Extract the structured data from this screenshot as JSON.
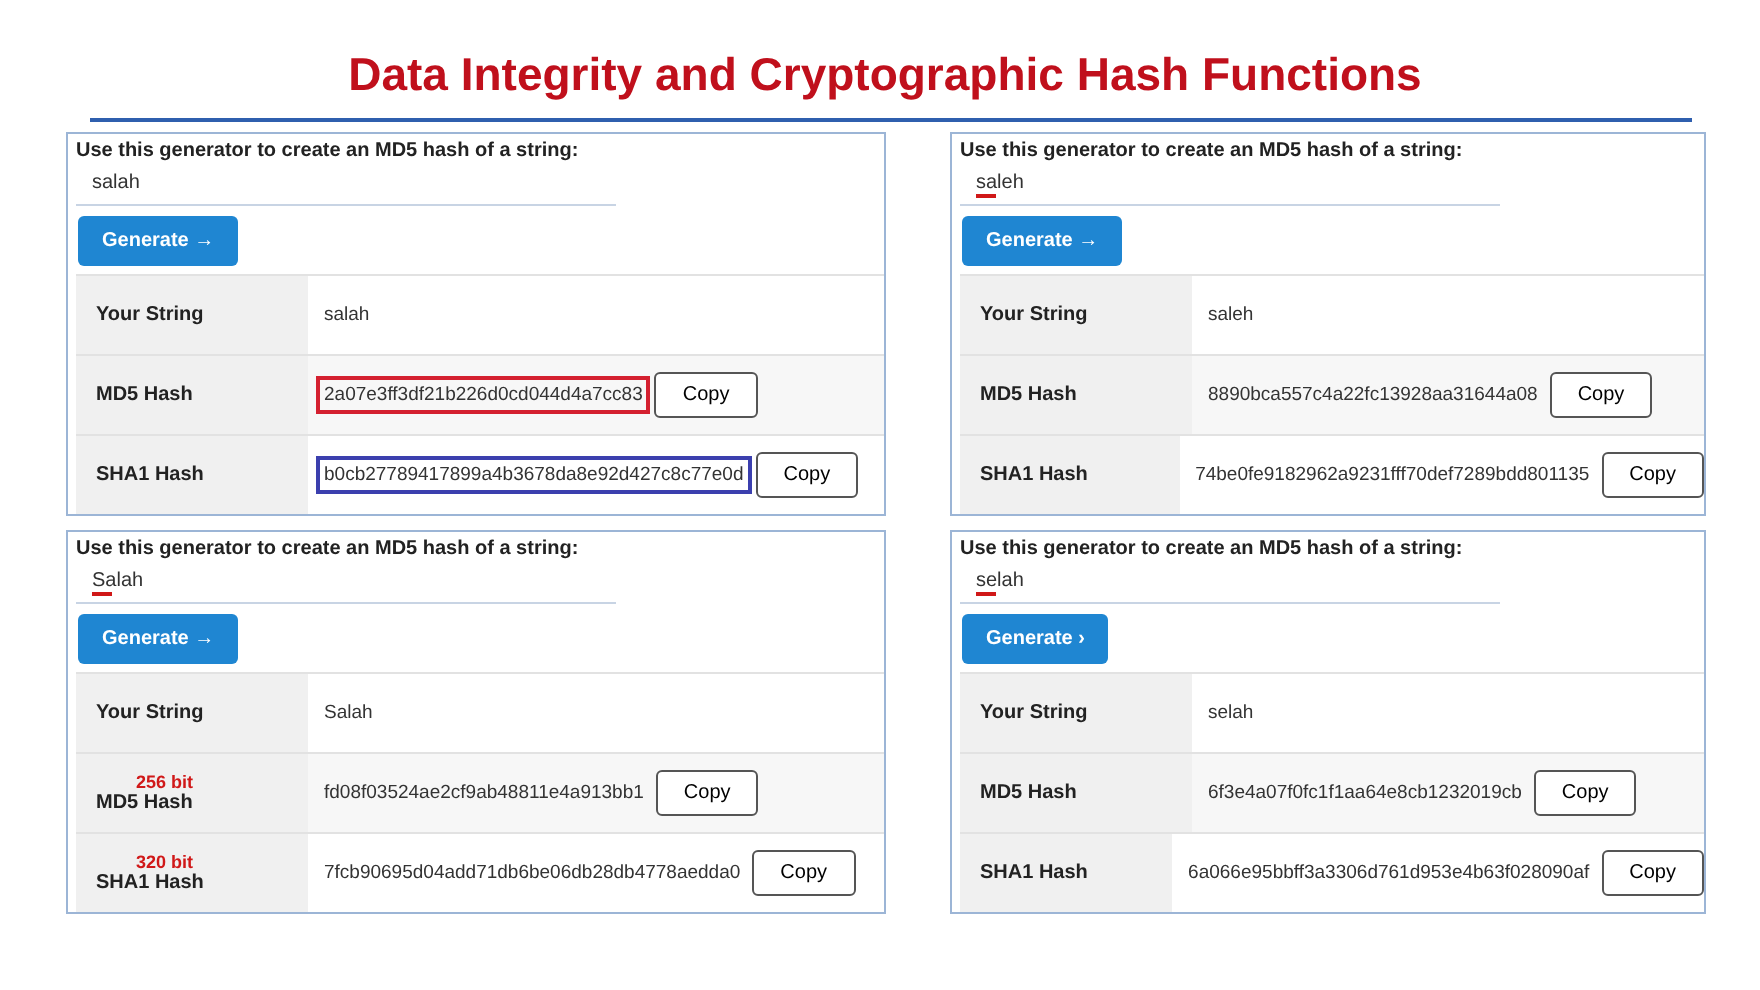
{
  "title": "Data Integrity and Cryptographic Hash Functions",
  "panels": [
    {
      "prompt": "Use this generator to create an MD5 hash of a string:",
      "input": {
        "value": "salah",
        "marked": false
      },
      "button": "Generate →",
      "rows": [
        {
          "label": "Your String",
          "value": "salah"
        },
        {
          "label": "MD5 Hash",
          "value": "2a07e3ff3df21b226d0cd044d4a7cc83",
          "copy": "Copy",
          "color": "#d42030"
        },
        {
          "label": "SHA1 Hash",
          "value": "b0cb27789417899a4b3678da8e92d427c8c77e0d",
          "copy": "Copy",
          "color": "#3b3fae"
        }
      ]
    },
    {
      "prompt": "Use this generator to create an MD5 hash of a string:",
      "input": {
        "value": "saleh",
        "marked": true
      },
      "button": "Generate →",
      "rows": [
        {
          "label": "Your String",
          "value": "saleh"
        },
        {
          "label": "MD5 Hash",
          "value": "8890bca557c4a22fc13928aa31644a08",
          "copy": "Copy"
        },
        {
          "label": "SHA1 Hash",
          "value": "74be0fe9182962a9231fff70def7289bdd801135",
          "copy": "Copy"
        }
      ]
    },
    {
      "prompt": "Use this generator to create an MD5 hash of a string:",
      "input": {
        "value": "Salah",
        "marked": true
      },
      "button": "Generate →",
      "rows": [
        {
          "label": "Your String",
          "value": "Salah"
        },
        {
          "note": "256 bit",
          "label": "MD5 Hash",
          "value": "fd08f03524ae2cf9ab48811e4a913bb1",
          "copy": "Copy"
        },
        {
          "note": "320 bit",
          "label": "SHA1 Hash",
          "value": "7fcb90695d04add71db6be06db28db4778aedda0",
          "copy": "Copy"
        }
      ]
    },
    {
      "prompt": "Use this generator to create an MD5 hash of a string:",
      "input": {
        "value": "selah",
        "marked": true
      },
      "button": "Generate ›",
      "rows": [
        {
          "label": "Your String",
          "value": "selah"
        },
        {
          "label": "MD5 Hash",
          "value": "6f3e4a07f0fc1f1aa64e8cb1232019cb",
          "copy": "Copy"
        },
        {
          "label": "SHA1 Hash",
          "value": "6a066e95bbff3a3306d761d953e4b63f028090af",
          "copy": "Copy"
        }
      ]
    }
  ]
}
